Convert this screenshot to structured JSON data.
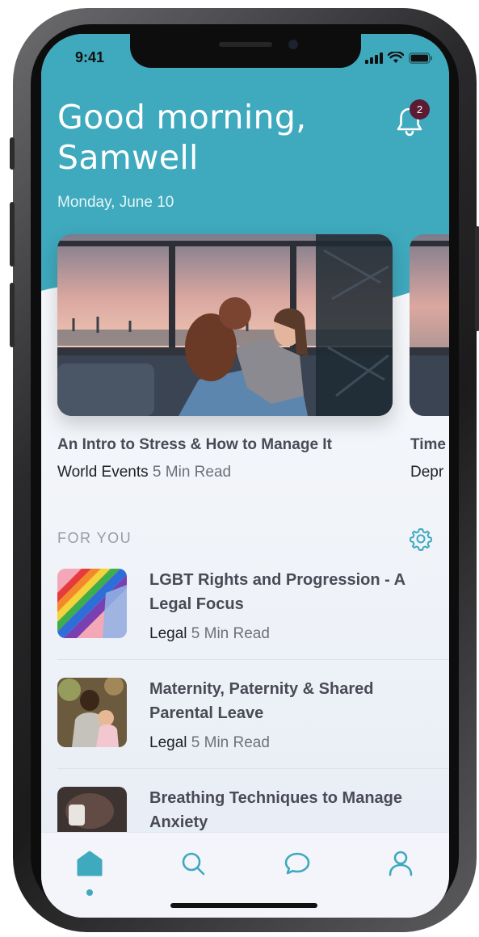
{
  "status_bar": {
    "time": "9:41"
  },
  "header": {
    "greeting": "Good morning, Samwell",
    "date": "Monday, June 10",
    "notification_count": "2"
  },
  "featured": [
    {
      "title": "An Intro to Stress & How to Manage It",
      "category": "World Events",
      "read_time": "5 Min Read"
    },
    {
      "title": "Time",
      "category": "Depr",
      "read_time": ""
    }
  ],
  "for_you": {
    "section_title": "FOR YOU",
    "items": [
      {
        "title": "LGBT Rights and Progression - A Legal Focus",
        "category": "Legal",
        "read_time": "5 Min Read"
      },
      {
        "title": "Maternity, Paternity & Shared Parental Leave",
        "category": "Legal",
        "read_time": "5 Min Read"
      },
      {
        "title": "Breathing Techniques to Manage Anxiety",
        "category": "",
        "read_time": ""
      }
    ]
  },
  "tab_bar": {
    "active": "home",
    "tabs": [
      {
        "icon": "home-icon"
      },
      {
        "icon": "search-icon"
      },
      {
        "icon": "chat-icon"
      },
      {
        "icon": "profile-icon"
      }
    ]
  },
  "colors": {
    "brand_teal": "#3fa9bd",
    "badge": "#5b1b35",
    "title_text": "#4a4a56",
    "muted_text": "#707078"
  }
}
